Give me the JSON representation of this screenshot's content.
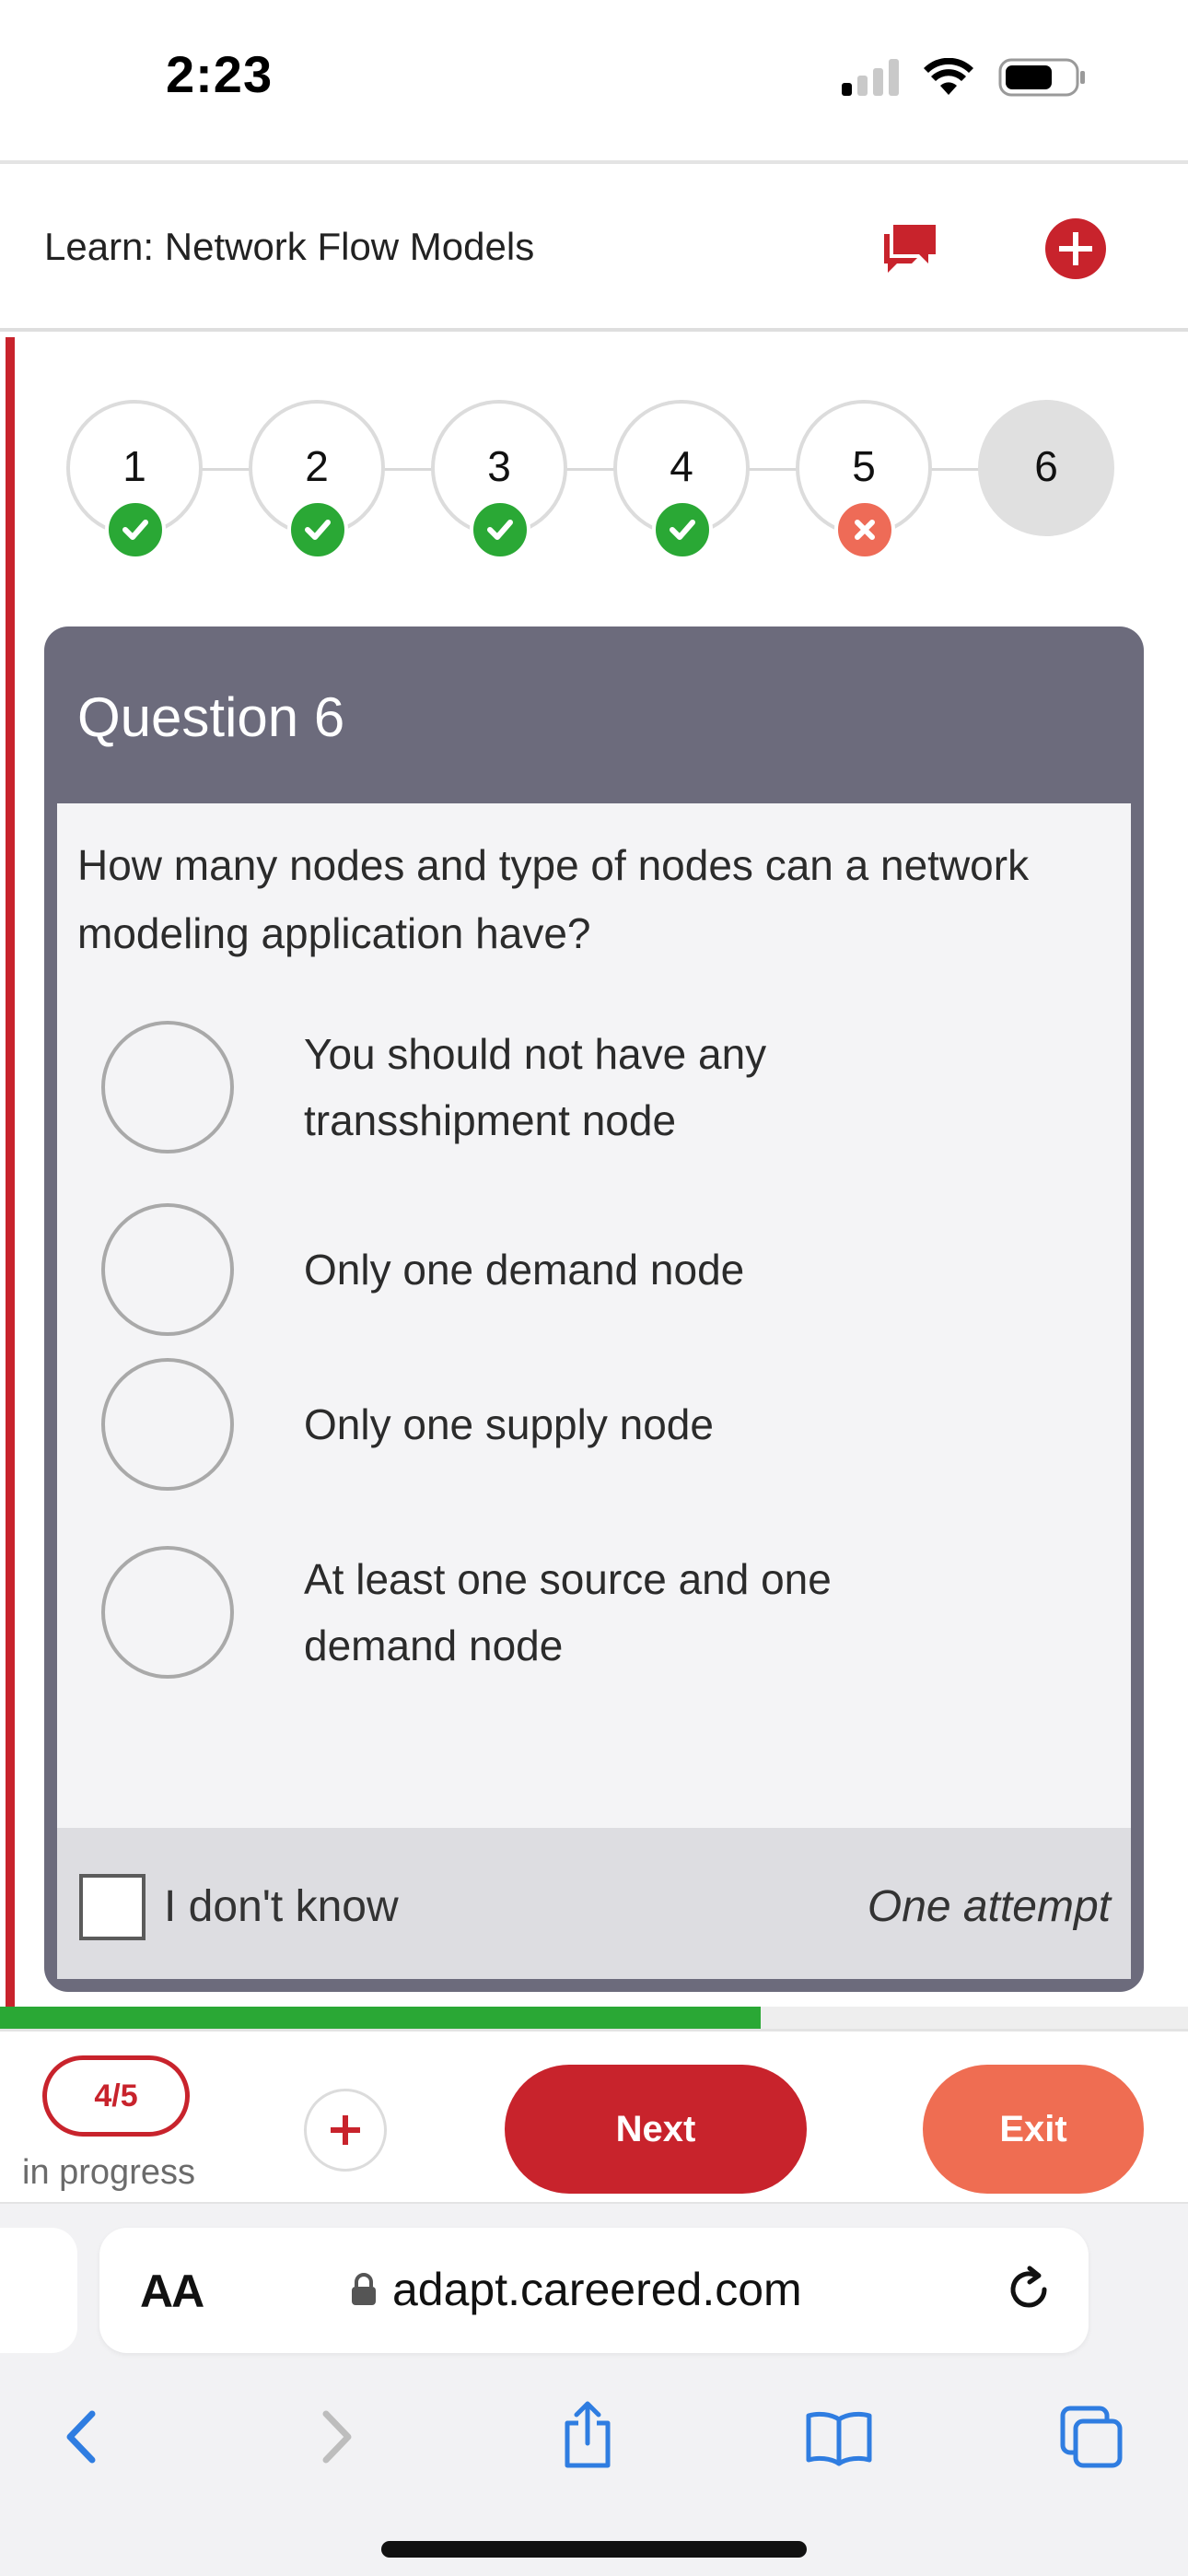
{
  "status_bar": {
    "time": "2:23"
  },
  "header": {
    "title": "Learn: Network Flow Models"
  },
  "steps": [
    {
      "label": "1",
      "status": "correct"
    },
    {
      "label": "2",
      "status": "correct"
    },
    {
      "label": "3",
      "status": "correct"
    },
    {
      "label": "4",
      "status": "correct"
    },
    {
      "label": "5",
      "status": "incorrect"
    },
    {
      "label": "6",
      "status": "current"
    }
  ],
  "question": {
    "title": "Question 6",
    "text": "How many nodes and type of nodes can a network modeling application have?",
    "options": [
      "You should not have any transshipment node",
      "Only one demand node",
      "Only one supply node",
      "At least one source and one demand node"
    ],
    "dont_know_label": "I don't know",
    "attempt_label": "One attempt"
  },
  "progress": {
    "fraction": 0.8
  },
  "action_bar": {
    "count": "4/5",
    "status": "in progress",
    "next_label": "Next",
    "exit_label": "Exit"
  },
  "browser": {
    "aa_label": "AA",
    "url": "adapt.careered.com"
  },
  "colors": {
    "brand_red": "#c8232c",
    "correct_green": "#2aa835",
    "incorrect_orange": "#ee6b57",
    "card_header": "#6c6b7c",
    "exit_orange": "#ef6d52",
    "ios_blue": "#2f7de1"
  },
  "icons": {
    "chat": "chat-bubbles-icon",
    "add": "plus-circle-icon",
    "lock": "lock-icon",
    "reload": "reload-icon",
    "back": "chevron-left-icon",
    "forward": "chevron-right-icon",
    "share": "share-icon",
    "bookmarks": "book-icon",
    "tabs": "tabs-icon"
  }
}
